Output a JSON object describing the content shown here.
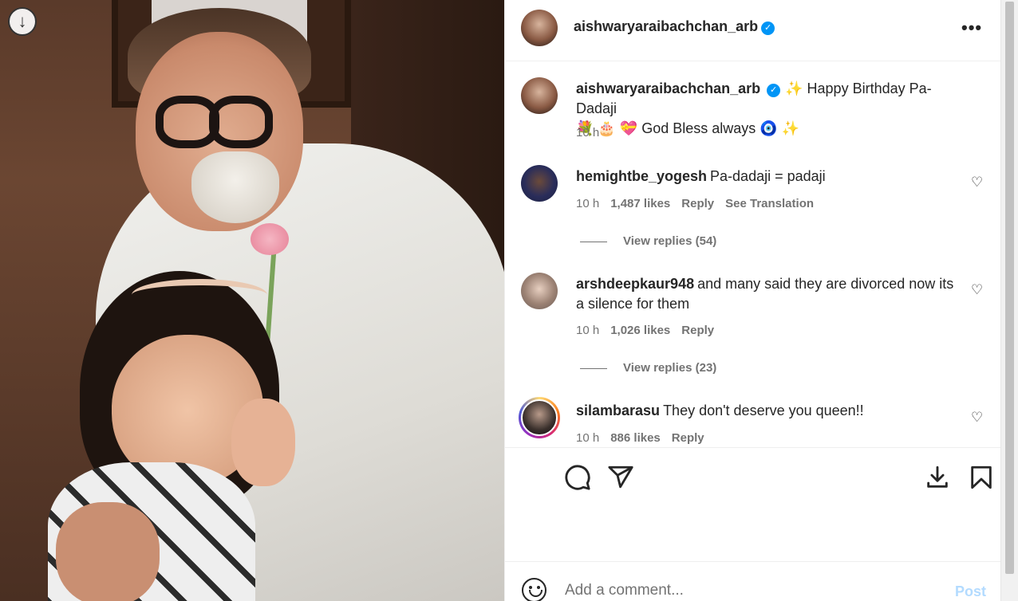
{
  "post": {
    "author": "aishwaryaraibachchan_arb",
    "verified_mark": "✓",
    "caption_line1": "✨ Happy Birthday Pa-Dadaji",
    "caption_line2": "💐 🎂 💝 God Bless always 🧿 ✨",
    "time": "10 h"
  },
  "comments": [
    {
      "user": "hemightbe_yogesh",
      "text": "Pa-dadaji = padaji",
      "time": "10 h",
      "likes": "1,487 likes",
      "reply": "Reply",
      "translation": "See Translation",
      "view_replies": "View replies (54)"
    },
    {
      "user": "arshdeepkaur948",
      "text": "and many said they are divorced now its a silence for them",
      "time": "10 h",
      "likes": "1,026 likes",
      "reply": "Reply",
      "view_replies": "View replies (23)"
    },
    {
      "user": "silambarasu",
      "text": "They don't deserve you queen!!",
      "time": "10 h",
      "likes": "886 likes",
      "reply": "Reply"
    }
  ],
  "add_comment": {
    "placeholder": "Add a comment...",
    "post_label": "Post"
  },
  "colors": {
    "verified": "#0095f6",
    "post_disabled": "#b3dbff",
    "meta": "#737373"
  },
  "icons": [
    "scroll-down-icon",
    "more-icon",
    "heart-icon",
    "comment-icon",
    "share-icon",
    "download-icon",
    "bookmark-icon",
    "emoji-icon"
  ]
}
